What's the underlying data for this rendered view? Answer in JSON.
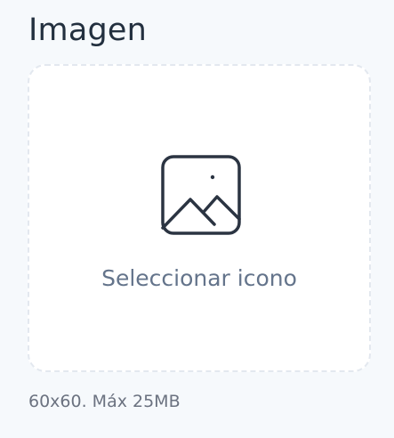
{
  "field": {
    "title": "Imagen"
  },
  "dropzone": {
    "label": "Seleccionar icono",
    "icon": "image-icon"
  },
  "hint": {
    "text": "60x60. Máx 25MB"
  },
  "colors": {
    "background": "#f6f9fc",
    "title": "#23303f",
    "dropzone_border": "#e3e8ef",
    "icon": "#2b3442",
    "muted_text": "#64748b"
  }
}
